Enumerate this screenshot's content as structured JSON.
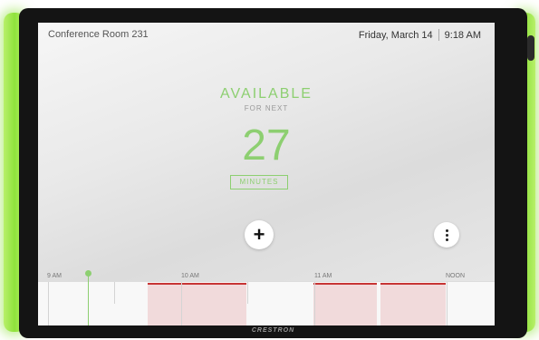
{
  "header": {
    "room_name": "Conference Room 231",
    "date": "Friday, March 14",
    "time": "9:18 AM"
  },
  "status": {
    "state": "AVAILABLE",
    "for_next": "FOR NEXT",
    "minutes": "27",
    "unit": "MINUTES"
  },
  "actions": {
    "add_icon": "plus-icon",
    "more_icon": "more-vertical-icon"
  },
  "timeline": {
    "labels": [
      "9 AM",
      "10 AM",
      "11 AM",
      "NOON"
    ],
    "current_time": "9:18 AM",
    "meetings": [
      {
        "start": "9:45 AM",
        "end": "10:30 AM"
      },
      {
        "start": "11:00 AM",
        "end": "11:15 AM"
      },
      {
        "start": "11:15 AM",
        "end": "11:45 AM"
      }
    ]
  },
  "brand": "CRESTRON",
  "colors": {
    "available": "#8dcf71",
    "meeting_fill": "#f1dadb",
    "meeting_line": "#c73535",
    "led": "#8fe23c"
  }
}
